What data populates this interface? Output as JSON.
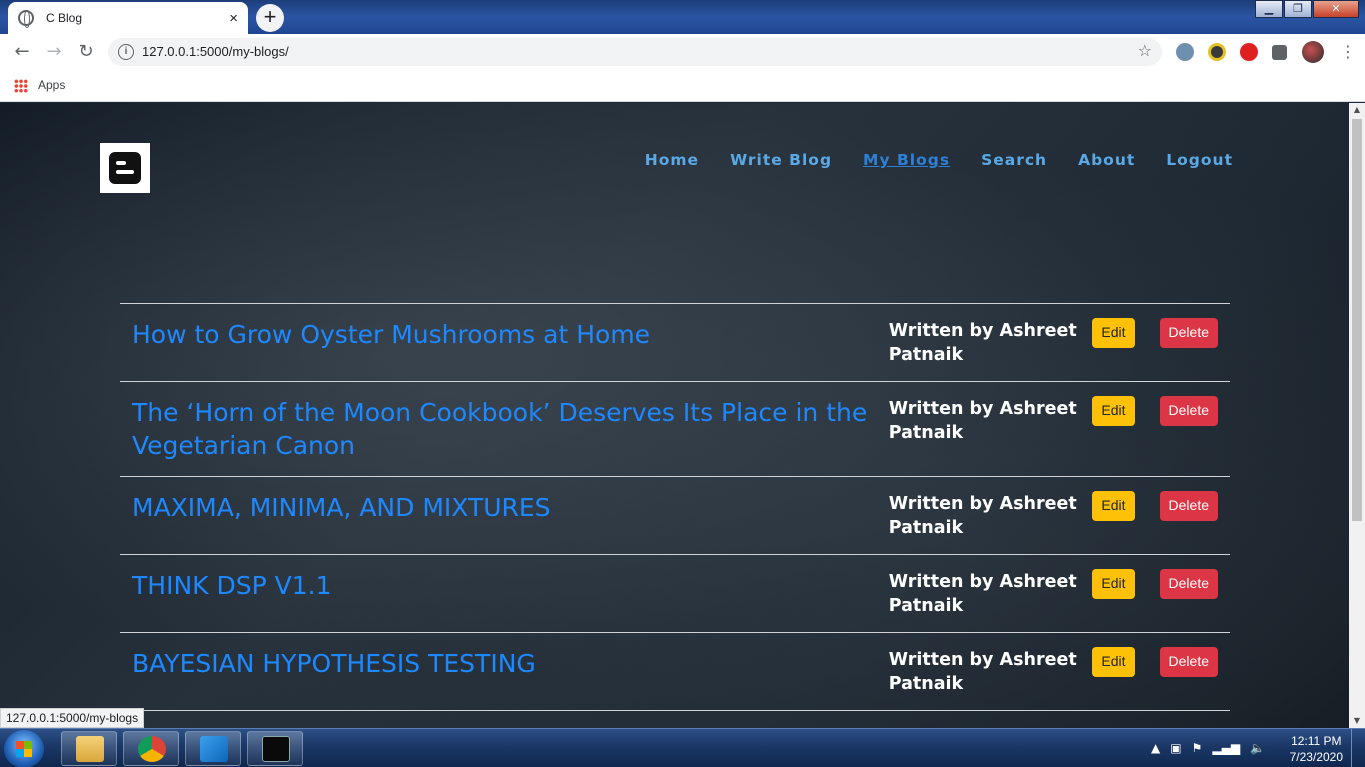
{
  "browser": {
    "tab_title": "C Blog",
    "tab_close": "×",
    "new_tab": "+",
    "url": "127.0.0.1:5000/my-blogs/",
    "bookmarks_apps_label": "Apps",
    "status_url": "127.0.0.1:5000/my-blogs"
  },
  "nav": {
    "items": [
      {
        "label": "Home"
      },
      {
        "label": "Write Blog"
      },
      {
        "label": "My Blogs"
      },
      {
        "label": "Search"
      },
      {
        "label": "About"
      },
      {
        "label": "Logout"
      }
    ]
  },
  "posts": [
    {
      "title": "How to Grow Oyster Mushrooms at Home",
      "author": "Written by Ashreet Patnaik",
      "edit": "Edit",
      "delete": "Delete"
    },
    {
      "title": "The ‘Horn of the Moon Cookbook’ Deserves Its Place in the Vegetarian Canon",
      "author": "Written by Ashreet Patnaik",
      "edit": "Edit",
      "delete": "Delete"
    },
    {
      "title": "MAXIMA, MINIMA, AND MIXTURES",
      "author": "Written by Ashreet Patnaik",
      "edit": "Edit",
      "delete": "Delete"
    },
    {
      "title": "THINK DSP V1.1",
      "author": "Written by Ashreet Patnaik",
      "edit": "Edit",
      "delete": "Delete"
    },
    {
      "title": "BAYESIAN HYPOTHESIS TESTING",
      "author": "Written by Ashreet Patnaik",
      "edit": "Edit",
      "delete": "Delete"
    }
  ],
  "taskbar": {
    "time": "12:11 PM",
    "date": "7/23/2020"
  },
  "colors": {
    "link": "#1e88ff",
    "nav": "#5aa9e6",
    "edit_button": "#ffc107",
    "delete_button": "#dc3545"
  }
}
